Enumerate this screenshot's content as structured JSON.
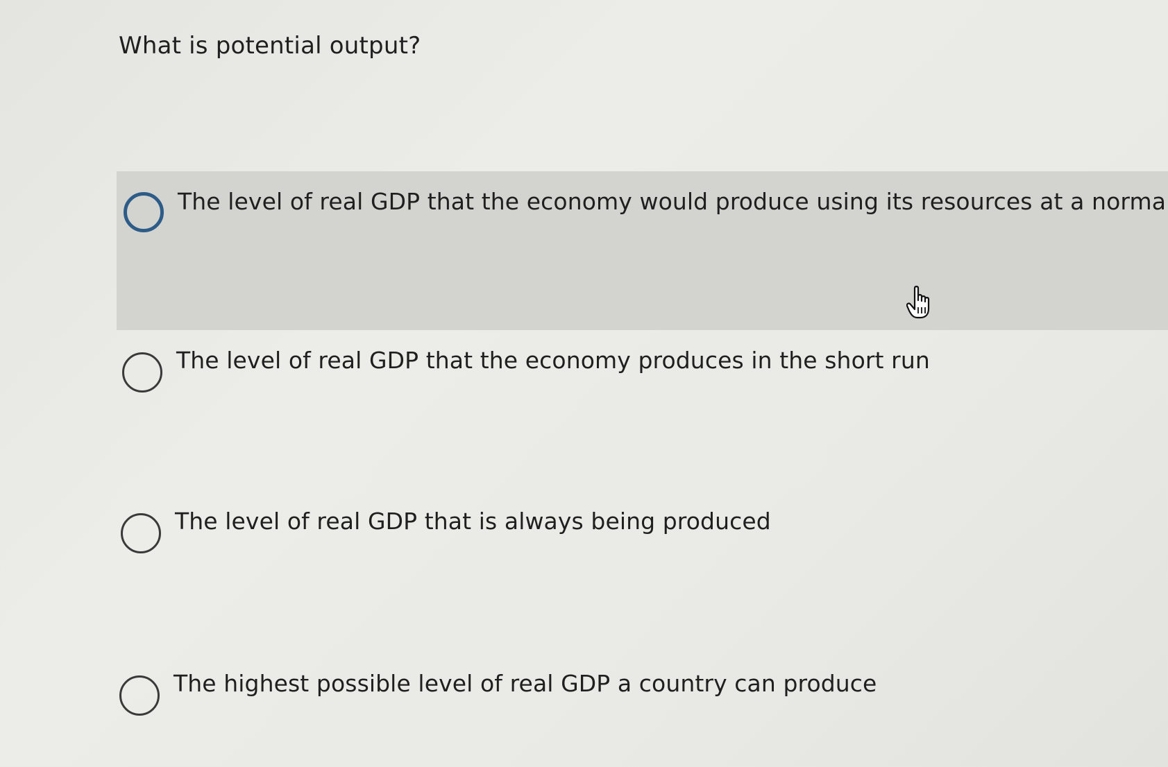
{
  "question": {
    "text": "What is potential output?"
  },
  "options": [
    {
      "label": "The level of real GDP that the economy would produce using its resources at a normal rate",
      "hovered": true
    },
    {
      "label": "The level of real GDP that the economy produces in the short run",
      "hovered": false
    },
    {
      "label": "The level of real GDP that is always being produced",
      "hovered": false
    },
    {
      "label": "The highest possible level of real GDP a country can produce",
      "hovered": false
    }
  ],
  "colors": {
    "background": "#e9e9e5",
    "hover_row": "#d3d3d0",
    "hover_radio": "#2d5c88",
    "radio": "#3a3a3a",
    "text": "#1f1f1f"
  },
  "icons": {
    "cursor": "hand-pointer-icon",
    "radio": "radio-circle-icon"
  }
}
